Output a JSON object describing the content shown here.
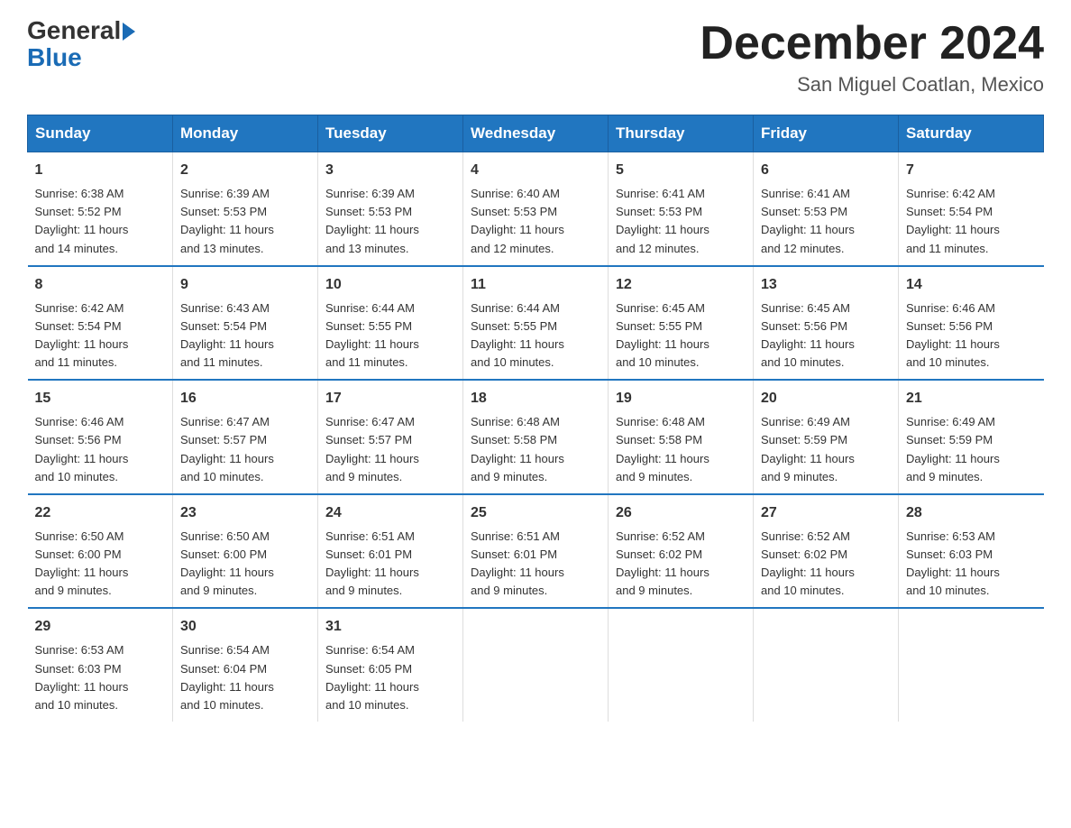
{
  "header": {
    "logo_general": "General",
    "logo_blue": "Blue",
    "month_title": "December 2024",
    "location": "San Miguel Coatlan, Mexico"
  },
  "columns": [
    "Sunday",
    "Monday",
    "Tuesday",
    "Wednesday",
    "Thursday",
    "Friday",
    "Saturday"
  ],
  "weeks": [
    [
      {
        "day": "1",
        "info": "Sunrise: 6:38 AM\nSunset: 5:52 PM\nDaylight: 11 hours\nand 14 minutes."
      },
      {
        "day": "2",
        "info": "Sunrise: 6:39 AM\nSunset: 5:53 PM\nDaylight: 11 hours\nand 13 minutes."
      },
      {
        "day": "3",
        "info": "Sunrise: 6:39 AM\nSunset: 5:53 PM\nDaylight: 11 hours\nand 13 minutes."
      },
      {
        "day": "4",
        "info": "Sunrise: 6:40 AM\nSunset: 5:53 PM\nDaylight: 11 hours\nand 12 minutes."
      },
      {
        "day": "5",
        "info": "Sunrise: 6:41 AM\nSunset: 5:53 PM\nDaylight: 11 hours\nand 12 minutes."
      },
      {
        "day": "6",
        "info": "Sunrise: 6:41 AM\nSunset: 5:53 PM\nDaylight: 11 hours\nand 12 minutes."
      },
      {
        "day": "7",
        "info": "Sunrise: 6:42 AM\nSunset: 5:54 PM\nDaylight: 11 hours\nand 11 minutes."
      }
    ],
    [
      {
        "day": "8",
        "info": "Sunrise: 6:42 AM\nSunset: 5:54 PM\nDaylight: 11 hours\nand 11 minutes."
      },
      {
        "day": "9",
        "info": "Sunrise: 6:43 AM\nSunset: 5:54 PM\nDaylight: 11 hours\nand 11 minutes."
      },
      {
        "day": "10",
        "info": "Sunrise: 6:44 AM\nSunset: 5:55 PM\nDaylight: 11 hours\nand 11 minutes."
      },
      {
        "day": "11",
        "info": "Sunrise: 6:44 AM\nSunset: 5:55 PM\nDaylight: 11 hours\nand 10 minutes."
      },
      {
        "day": "12",
        "info": "Sunrise: 6:45 AM\nSunset: 5:55 PM\nDaylight: 11 hours\nand 10 minutes."
      },
      {
        "day": "13",
        "info": "Sunrise: 6:45 AM\nSunset: 5:56 PM\nDaylight: 11 hours\nand 10 minutes."
      },
      {
        "day": "14",
        "info": "Sunrise: 6:46 AM\nSunset: 5:56 PM\nDaylight: 11 hours\nand 10 minutes."
      }
    ],
    [
      {
        "day": "15",
        "info": "Sunrise: 6:46 AM\nSunset: 5:56 PM\nDaylight: 11 hours\nand 10 minutes."
      },
      {
        "day": "16",
        "info": "Sunrise: 6:47 AM\nSunset: 5:57 PM\nDaylight: 11 hours\nand 10 minutes."
      },
      {
        "day": "17",
        "info": "Sunrise: 6:47 AM\nSunset: 5:57 PM\nDaylight: 11 hours\nand 9 minutes."
      },
      {
        "day": "18",
        "info": "Sunrise: 6:48 AM\nSunset: 5:58 PM\nDaylight: 11 hours\nand 9 minutes."
      },
      {
        "day": "19",
        "info": "Sunrise: 6:48 AM\nSunset: 5:58 PM\nDaylight: 11 hours\nand 9 minutes."
      },
      {
        "day": "20",
        "info": "Sunrise: 6:49 AM\nSunset: 5:59 PM\nDaylight: 11 hours\nand 9 minutes."
      },
      {
        "day": "21",
        "info": "Sunrise: 6:49 AM\nSunset: 5:59 PM\nDaylight: 11 hours\nand 9 minutes."
      }
    ],
    [
      {
        "day": "22",
        "info": "Sunrise: 6:50 AM\nSunset: 6:00 PM\nDaylight: 11 hours\nand 9 minutes."
      },
      {
        "day": "23",
        "info": "Sunrise: 6:50 AM\nSunset: 6:00 PM\nDaylight: 11 hours\nand 9 minutes."
      },
      {
        "day": "24",
        "info": "Sunrise: 6:51 AM\nSunset: 6:01 PM\nDaylight: 11 hours\nand 9 minutes."
      },
      {
        "day": "25",
        "info": "Sunrise: 6:51 AM\nSunset: 6:01 PM\nDaylight: 11 hours\nand 9 minutes."
      },
      {
        "day": "26",
        "info": "Sunrise: 6:52 AM\nSunset: 6:02 PM\nDaylight: 11 hours\nand 9 minutes."
      },
      {
        "day": "27",
        "info": "Sunrise: 6:52 AM\nSunset: 6:02 PM\nDaylight: 11 hours\nand 10 minutes."
      },
      {
        "day": "28",
        "info": "Sunrise: 6:53 AM\nSunset: 6:03 PM\nDaylight: 11 hours\nand 10 minutes."
      }
    ],
    [
      {
        "day": "29",
        "info": "Sunrise: 6:53 AM\nSunset: 6:03 PM\nDaylight: 11 hours\nand 10 minutes."
      },
      {
        "day": "30",
        "info": "Sunrise: 6:54 AM\nSunset: 6:04 PM\nDaylight: 11 hours\nand 10 minutes."
      },
      {
        "day": "31",
        "info": "Sunrise: 6:54 AM\nSunset: 6:05 PM\nDaylight: 11 hours\nand 10 minutes."
      },
      {
        "day": "",
        "info": ""
      },
      {
        "day": "",
        "info": ""
      },
      {
        "day": "",
        "info": ""
      },
      {
        "day": "",
        "info": ""
      }
    ]
  ]
}
